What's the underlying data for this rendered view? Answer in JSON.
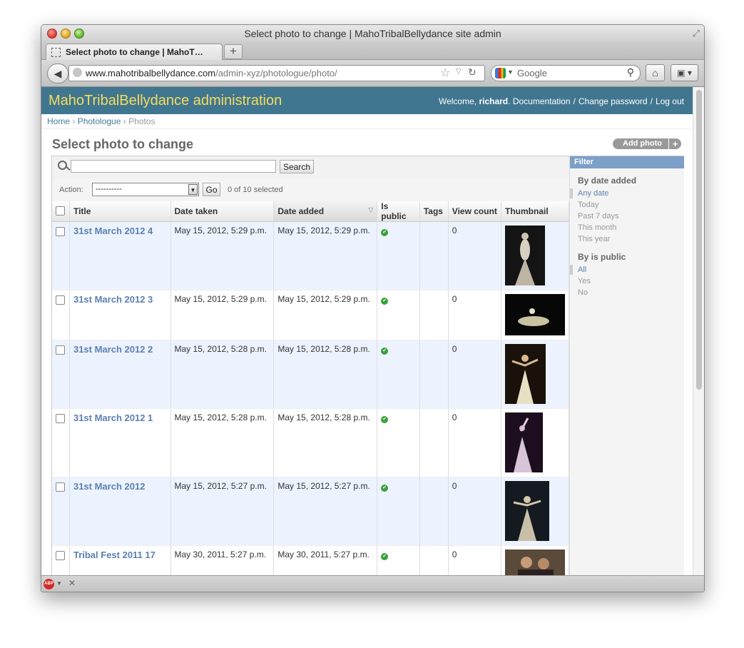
{
  "browser": {
    "window_title": "Select photo to change | MahoTribalBellydance site admin",
    "tab_title": "Select photo to change | MahoT…",
    "url_host": "www.mahotribalbellydance.com",
    "url_path": "/admin-xyz/photologue/photo/",
    "search_placeholder": "Google"
  },
  "header": {
    "site_name": "MahoTribalBellydance administration",
    "welcome": "Welcome,",
    "username": "richard",
    "documentation": "Documentation",
    "change_password": "Change password",
    "logout": "Log out"
  },
  "breadcrumbs": {
    "home": "Home",
    "app": "Photologue",
    "current": "Photos"
  },
  "page": {
    "title": "Select photo to change",
    "add_button": "Add photo"
  },
  "search": {
    "button": "Search",
    "value": ""
  },
  "actions": {
    "label": "Action:",
    "selected": "----------",
    "go": "Go",
    "count": "0 of 10 selected"
  },
  "columns": [
    "Title",
    "Date taken",
    "Date added",
    "Is public",
    "Tags",
    "View count",
    "Thumbnail"
  ],
  "rows": [
    {
      "title": "31st March 2012 4",
      "date_taken": "May 15, 2012, 5:29 p.m.",
      "date_added": "May 15, 2012, 5:29 p.m.",
      "tags": "",
      "views": "0"
    },
    {
      "title": "31st March 2012 3",
      "date_taken": "May 15, 2012, 5:29 p.m.",
      "date_added": "May 15, 2012, 5:29 p.m.",
      "tags": "",
      "views": "0"
    },
    {
      "title": "31st March 2012 2",
      "date_taken": "May 15, 2012, 5:28 p.m.",
      "date_added": "May 15, 2012, 5:28 p.m.",
      "tags": "",
      "views": "0"
    },
    {
      "title": "31st March 2012 1",
      "date_taken": "May 15, 2012, 5:28 p.m.",
      "date_added": "May 15, 2012, 5:28 p.m.",
      "tags": "",
      "views": "0"
    },
    {
      "title": "31st March 2012",
      "date_taken": "May 15, 2012, 5:27 p.m.",
      "date_added": "May 15, 2012, 5:27 p.m.",
      "tags": "",
      "views": "0"
    },
    {
      "title": "Tribal Fest 2011 17",
      "date_taken": "May 30, 2011, 5:27 p.m.",
      "date_added": "May 30, 2011, 5:27 p.m.",
      "tags": "",
      "views": "0"
    }
  ],
  "filter": {
    "heading": "Filter",
    "date_heading": "By date added",
    "date_options": [
      "Any date",
      "Today",
      "Past 7 days",
      "This month",
      "This year"
    ],
    "public_heading": "By is public",
    "public_options": [
      "All",
      "Yes",
      "No"
    ]
  },
  "colors": {
    "header_bg": "#417690",
    "site_name": "#f5dd5d",
    "link": "#5b80b2",
    "filter_head": "#7ca0c7",
    "row_alt": "#edf3fe"
  }
}
